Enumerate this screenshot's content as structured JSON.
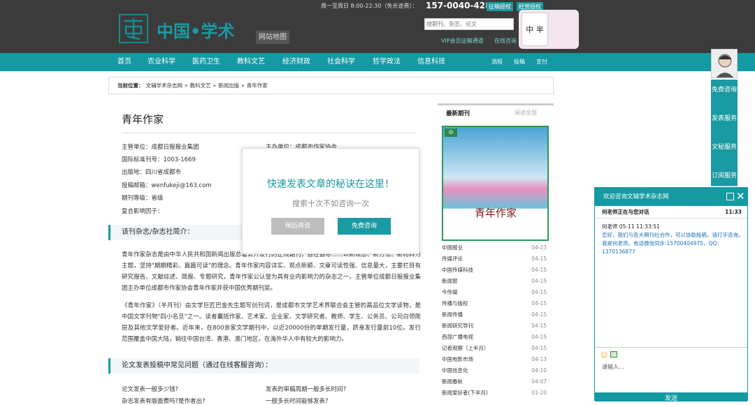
{
  "header": {
    "hours": "周一至周日 8:00-22:30（免长途费）：",
    "phone": "157-0040-4284",
    "tags": [
      "征稿授权",
      "经营授权"
    ],
    "logo_text": "中国•学术",
    "sitemap": "网站地图",
    "search_placeholder": "搜期刊、杂志、论文",
    "vip": "VIP会员征稿通道",
    "online": "在线咨询",
    "qr_label": "中 半"
  },
  "nav": {
    "items": [
      "首页",
      "农业科学",
      "医药卫生",
      "教科文艺",
      "经济财政",
      "社会科学",
      "哲学政法",
      "信息科技"
    ],
    "right": [
      "流程",
      "投稿",
      "支付"
    ]
  },
  "breadcrumb": [
    "当前位置：",
    "文辅学术杂志网",
    "»",
    "教科文艺",
    "»",
    "新闻出版",
    "»",
    "青年作家"
  ],
  "page": {
    "title": "青年作家",
    "info": [
      {
        "label": "主管单位：",
        "value": "成都日报报业集团"
      },
      {
        "label": "主办单位：",
        "value": "成都市作家协会"
      },
      {
        "label": "国际标准刊号：",
        "value": "1003-1669"
      },
      {
        "label": "出版地：",
        "value": "四川省成都市"
      },
      {
        "label": "投稿邮箱：",
        "value": "wenfukeji@163.com"
      },
      {
        "label": "期刊等级：",
        "value": "省级"
      },
      {
        "label": "复合影响因子：",
        "value": ""
      }
    ],
    "intro_heading": "该刊杂志/杂志社简介：",
    "intro_p1": "青年作家杂志是由中华人民共和国新闻出版总署公开发行的正规期刊，旨在倡导……以新观念、新方法、新材料为主题，坚持\"期期精彩、篇篇可读\"的理念。青年作家内容详实、观点新颖、文章可读性强、信息量大，主要栏目有研究报告、文献综述、简报、专题研究，青年作家公认誉为具有业内影响力的杂志之一。主管单位成都日报报业集团主办单位成都市作家协会青年作家并获中国优秀期刊奖。",
    "intro_p2": "《青年作家》（半月刊）由文学巨匠巴金先生题写创刊词，是成都市文学艺术界联合会主管的高品位文学读物，是中国文学刊物\"四小名旦\"之一。读者囊括作家、艺术家、企业家、文学研究者、教师、学生、公务员、公司白领爬层及其他文学爱好者。近年来，在800余家文学期刊中，以近20000份的单期发行量，跻身发行量前10位。发行范围覆盖中国大陆，销往中国台湾、香港、澳门地区，在海外华人中有较大的影响力。",
    "faq_heading": "论文发表投稿中常见问题（通过在线客服咨询）：",
    "faq": [
      "论文发表一般多少钱?",
      "发表的审稿周期一般多长时间?",
      "杂志发表有版面费吗?是作者出?",
      "一般多长时间能够发表?"
    ]
  },
  "sidebar": {
    "tab_active": "最新期刊",
    "tab_more": "阅读全部",
    "cover_badge": "中",
    "cover_title": "青年作家",
    "list": [
      {
        "name": "中国报业",
        "date": "04-23"
      },
      {
        "name": "传媒评论",
        "date": "04-15"
      },
      {
        "name": "中国传媒科技",
        "date": "04-15"
      },
      {
        "name": "新闻窗",
        "date": "04-15"
      },
      {
        "name": "今传媒",
        "date": "04-15"
      },
      {
        "name": "传播与版权",
        "date": "04-15"
      },
      {
        "name": "新闻传播",
        "date": "04-15"
      },
      {
        "name": "新闻研究导刊",
        "date": "04-15"
      },
      {
        "name": "西部广播电视",
        "date": "04-15"
      },
      {
        "name": "记者观察（上半月）",
        "date": "04-15"
      },
      {
        "name": "中国电影市场",
        "date": "04-13"
      },
      {
        "name": "中国信息化",
        "date": "04-10"
      },
      {
        "name": "新闻春秋",
        "date": "04-07"
      },
      {
        "name": "新闻爱好者(下半月)",
        "date": "01-20"
      }
    ]
  },
  "float_tabs": [
    "免费咨询",
    "发表服务",
    "文秘服务",
    "订阅服务"
  ],
  "modal": {
    "title": "快速发表文章的秘诀在这里！",
    "subtitle": "搜索十次不如咨询一次",
    "later": "稍后再说",
    "consult": "免费咨询",
    "colors": {
      "accent": "#1a9aa2",
      "gray_button": "#bdbdbd"
    }
  },
  "chat": {
    "title": "欢迎咨询文辅学术杂志网",
    "status": "何老师正在与您对话",
    "status_time": "11:33",
    "sender": "何老师 05-11 11:33:51",
    "message": "您好，我们与各大期刊社合作，可以协助投稿，请打字咨询，我是何老师。电话微信同步:15700404975，QQ：1370136877",
    "input_placeholder": "请输入...",
    "send": "发送"
  }
}
